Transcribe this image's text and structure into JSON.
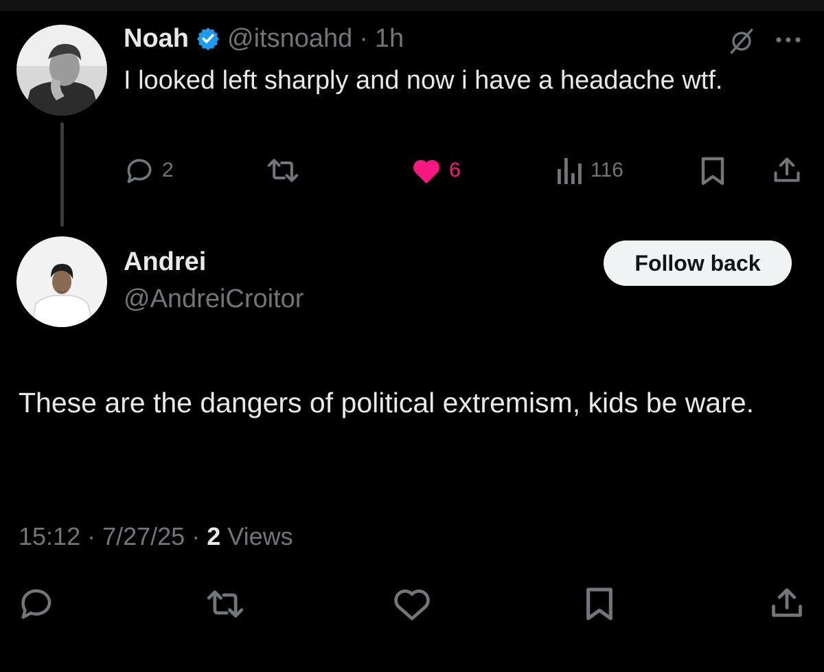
{
  "parent_tweet": {
    "author_name": "Noah",
    "handle": "@itsnoahd",
    "separator": "·",
    "time": "1h",
    "text": "I looked left sharply and now i have a headache wtf.",
    "metrics": {
      "replies": "2",
      "likes": "6",
      "views": "116"
    },
    "icons": [
      "verified-badge-icon",
      "grok-icon",
      "more-icon",
      "reply-icon",
      "retweet-icon",
      "heart-filled-icon",
      "views-icon",
      "bookmark-icon",
      "share-icon"
    ]
  },
  "reply_tweet": {
    "author_name": "Andrei",
    "handle": "@AndreiCroitor",
    "follow_label": "Follow back",
    "text": "These are the dangers of political extremism, kids be ware.",
    "meta": {
      "time": "15:12",
      "sep1": "·",
      "date": "7/27/25",
      "sep2": "·",
      "views_count": "2",
      "views_label": "Views"
    },
    "icons": [
      "reply-icon",
      "retweet-icon",
      "heart-outline-icon",
      "bookmark-icon",
      "share-icon"
    ]
  },
  "colors": {
    "background": "#000000",
    "text": "#e7e9ea",
    "secondary": "#71767b",
    "like": "#f91880",
    "verified": "#1d9bf0",
    "button_bg": "#eff3f4"
  }
}
